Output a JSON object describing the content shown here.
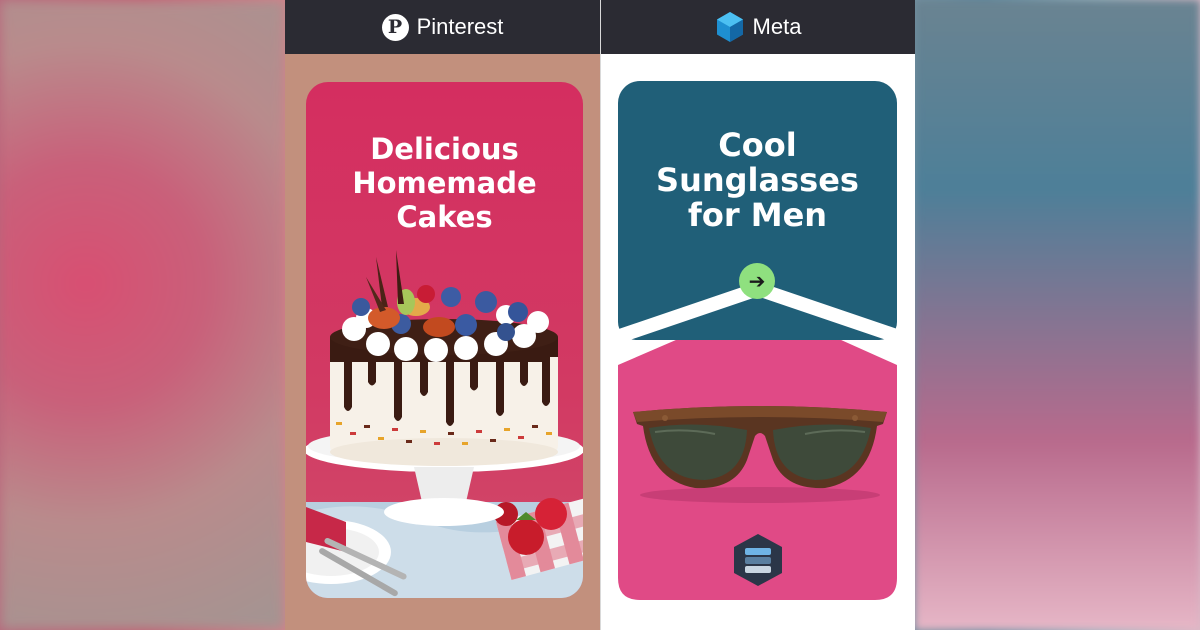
{
  "left_panel": {
    "brand": "Pinterest",
    "brand_icon": "pinterest-icon",
    "card": {
      "title_lines": [
        "Delicious",
        "Homemade",
        "Cakes"
      ],
      "image": "chocolate-drip-cake-photo",
      "bg_color": "#d42e60"
    }
  },
  "right_panel": {
    "brand": "Meta",
    "brand_icon": "meta-icon",
    "top_card": {
      "title_lines": [
        "Cool",
        "Sunglasses",
        "for Men"
      ],
      "bg_color": "#205f78",
      "cta_icon": "arrow-right-icon"
    },
    "bottom_card": {
      "image": "sunglasses-photo",
      "bg_color": "#e04a86",
      "badge_icon": "stacked-layers-logo-icon"
    }
  }
}
